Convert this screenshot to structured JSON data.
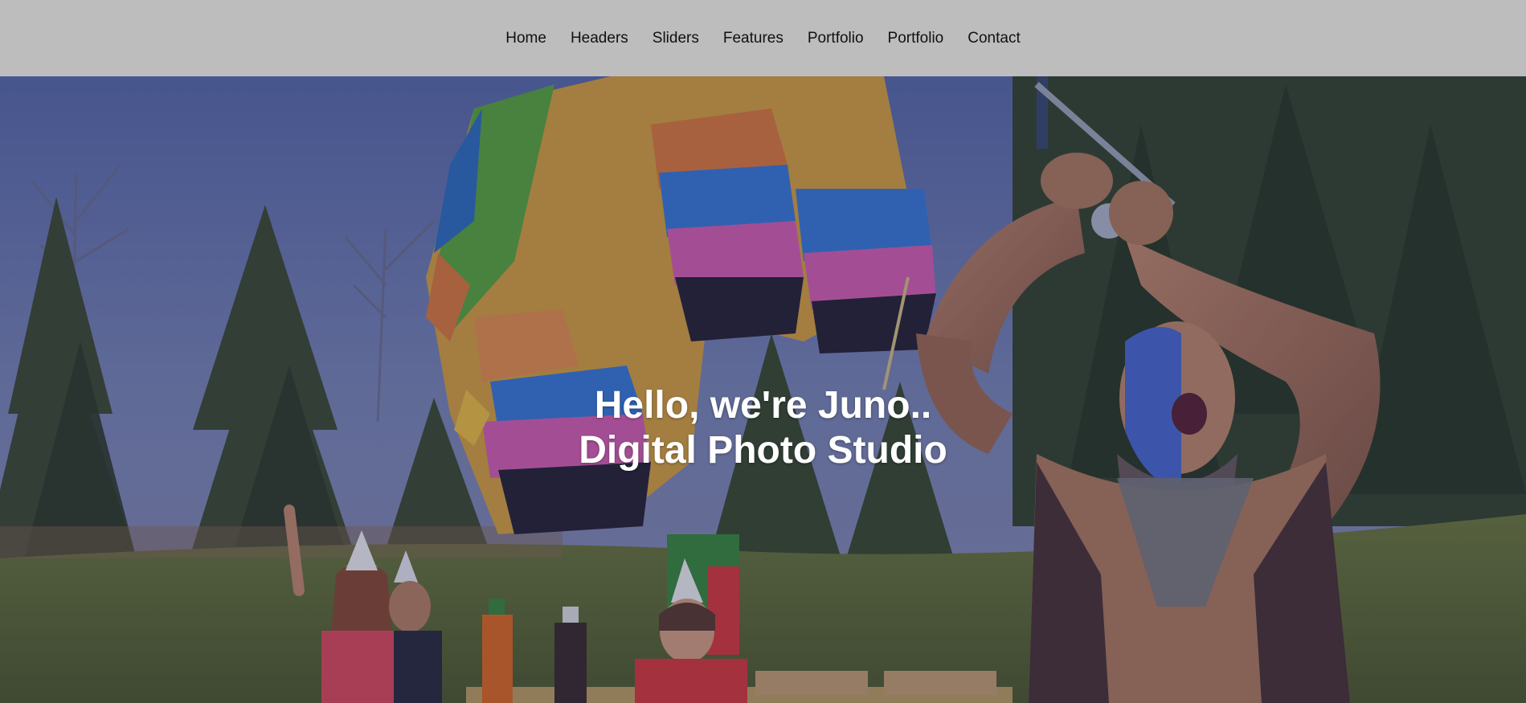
{
  "nav": {
    "items": [
      {
        "label": "Home",
        "id": "home"
      },
      {
        "label": "Headers",
        "id": "headers"
      },
      {
        "label": "Sliders",
        "id": "sliders"
      },
      {
        "label": "Features",
        "id": "features"
      },
      {
        "label": "Portfolio",
        "id": "portfolio-1"
      },
      {
        "label": "Portfolio",
        "id": "portfolio-2"
      },
      {
        "label": "Contact",
        "id": "contact"
      }
    ]
  },
  "hero": {
    "line1": "Hello, we're Juno..",
    "line2": "Digital Photo Studio"
  },
  "colors": {
    "nav_background": "#bdbdbd",
    "nav_text": "#111111",
    "hero_text": "#ffffff",
    "hero_overlay": "#1a1f4a"
  }
}
